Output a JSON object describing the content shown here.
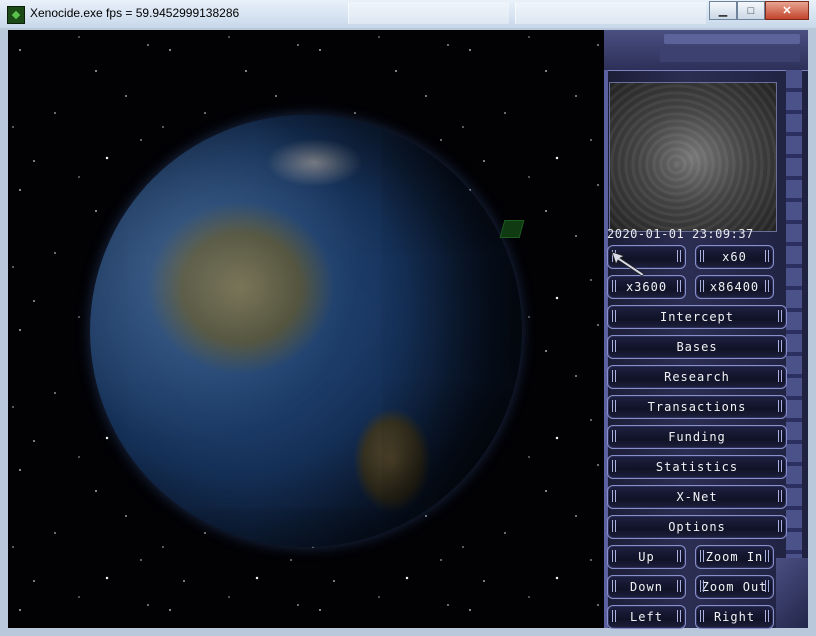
{
  "window": {
    "title": "Xenocide.exe  fps = 59.9452999138286",
    "minimize_glyph": "▁",
    "maximize_glyph": "□",
    "close_glyph": "✕"
  },
  "game": {
    "clock": "2020-01-01  23:09:37",
    "speed_buttons": {
      "x1": "",
      "x60": "x60",
      "x3600": "x3600",
      "x86400": "x86400"
    },
    "menu": {
      "intercept": "Intercept",
      "bases": "Bases",
      "research": "Research",
      "transactions": "Transactions",
      "funding": "Funding",
      "statistics": "Statistics",
      "xnet": "X-Net",
      "options": "Options"
    },
    "camera": {
      "up": "Up",
      "zoom_in": "Zoom In",
      "down": "Down",
      "zoom_out": "Zoom Out",
      "left": "Left",
      "right": "Right"
    }
  },
  "icons": [
    "xenocide-app-icon",
    "minimize-icon",
    "maximize-icon",
    "close-icon",
    "mouse-pointer-icon"
  ]
}
